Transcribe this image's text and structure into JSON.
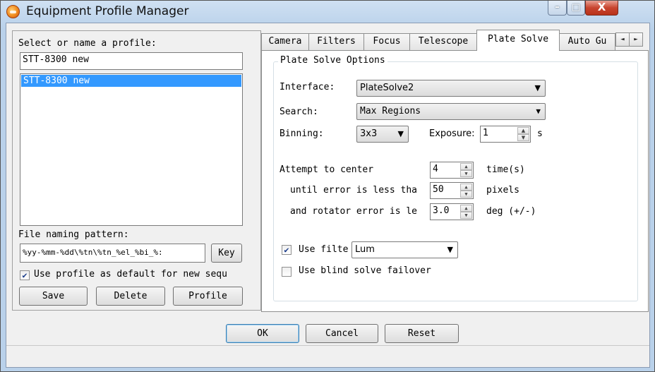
{
  "window": {
    "title": "Equipment Profile Manager",
    "min_glyph": "–",
    "max_glyph": "□",
    "close_glyph": "X"
  },
  "profile": {
    "select_label": "Select or name a profile:",
    "name_value": "STT-8300 new",
    "list_items": [
      "STT-8300 new"
    ],
    "file_naming_label": "File naming pattern:",
    "file_naming_value": "%yy-%mm-%dd\\%tn\\%tn_%el_%bi_%:",
    "key_button": "Key",
    "default_checkbox_label": "Use profile as default for new sequ",
    "default_checked": true,
    "save_button": "Save",
    "delete_button": "Delete",
    "profile_button": "Profile"
  },
  "tabs": [
    {
      "label": "Camera",
      "active": false
    },
    {
      "label": "Filters",
      "active": false
    },
    {
      "label": "Focus",
      "active": false
    },
    {
      "label": "Telescope",
      "active": false
    },
    {
      "label": "Plate Solve",
      "active": true
    },
    {
      "label": "Auto Gu",
      "active": false
    }
  ],
  "tab_scroll": {
    "left_icon": "◄",
    "right_icon": "►"
  },
  "plate_solve": {
    "group_title": "Plate Solve Options",
    "interface_label": "Interface:",
    "interface_value": "PlateSolve2",
    "search_label": "Search:",
    "search_value": "Max Regions",
    "binning_label": "Binning:",
    "binning_value": "3x3",
    "exposure_label": "Exposure:",
    "exposure_value": "1",
    "exposure_unit": "s",
    "attempt_label": "Attempt to center",
    "attempt_value": "4",
    "attempt_unit": "time(s)",
    "until_label": "until error is less tha",
    "until_value": "50",
    "until_unit": "pixels",
    "rotator_label": "and rotator error is le",
    "rotator_value": "3.0",
    "rotator_unit": "deg (+/-)",
    "use_filter_label": "Use filte",
    "use_filter_checked": true,
    "filter_value": "Lum",
    "blind_label": "Use blind solve failover",
    "blind_checked": false
  },
  "footer": {
    "ok_button": "OK",
    "cancel_button": "Cancel",
    "reset_button": "Reset"
  },
  "icons": {
    "dropdown": "▼",
    "spin_up": "▲",
    "spin_down": "▼",
    "check": "✔"
  }
}
